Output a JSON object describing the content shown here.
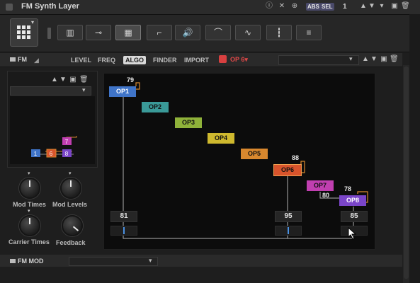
{
  "window": {
    "title": "FM Synth Layer",
    "tag_abs": "ABS",
    "tag_sel": "SEL",
    "counter": "1"
  },
  "section": {
    "name": "FM",
    "tabs": [
      "LEVEL",
      "FREQ",
      "ALGO",
      "FINDER",
      "IMPORT"
    ],
    "active_tab": "ALGO",
    "operator_select": "OP 6"
  },
  "knobs": [
    "Mod Times",
    "Mod Levels",
    "Carrier Times",
    "Feedback"
  ],
  "algorithm": {
    "operators": [
      {
        "label": "OP1",
        "color": "#3f74c8",
        "feedback": "79"
      },
      {
        "label": "OP2",
        "color": "#3a9a98",
        "feedback": ""
      },
      {
        "label": "OP3",
        "color": "#8fb23a",
        "feedback": ""
      },
      {
        "label": "OP4",
        "color": "#cfb92e",
        "feedback": ""
      },
      {
        "label": "OP5",
        "color": "#d9882e",
        "feedback": ""
      },
      {
        "label": "OP6",
        "color": "#d8542c",
        "feedback": "88"
      },
      {
        "label": "OP7",
        "color": "#c03fb0",
        "feedback": ""
      },
      {
        "label": "OP8",
        "color": "#7a45c8",
        "feedback": "78"
      }
    ],
    "mod_level_op7": "80",
    "output_levels": [
      "81",
      "95",
      "85"
    ]
  },
  "preview": {
    "ops": [
      "1",
      "6",
      "8",
      "7"
    ]
  },
  "bottom": {
    "section_name": "FM MOD"
  }
}
